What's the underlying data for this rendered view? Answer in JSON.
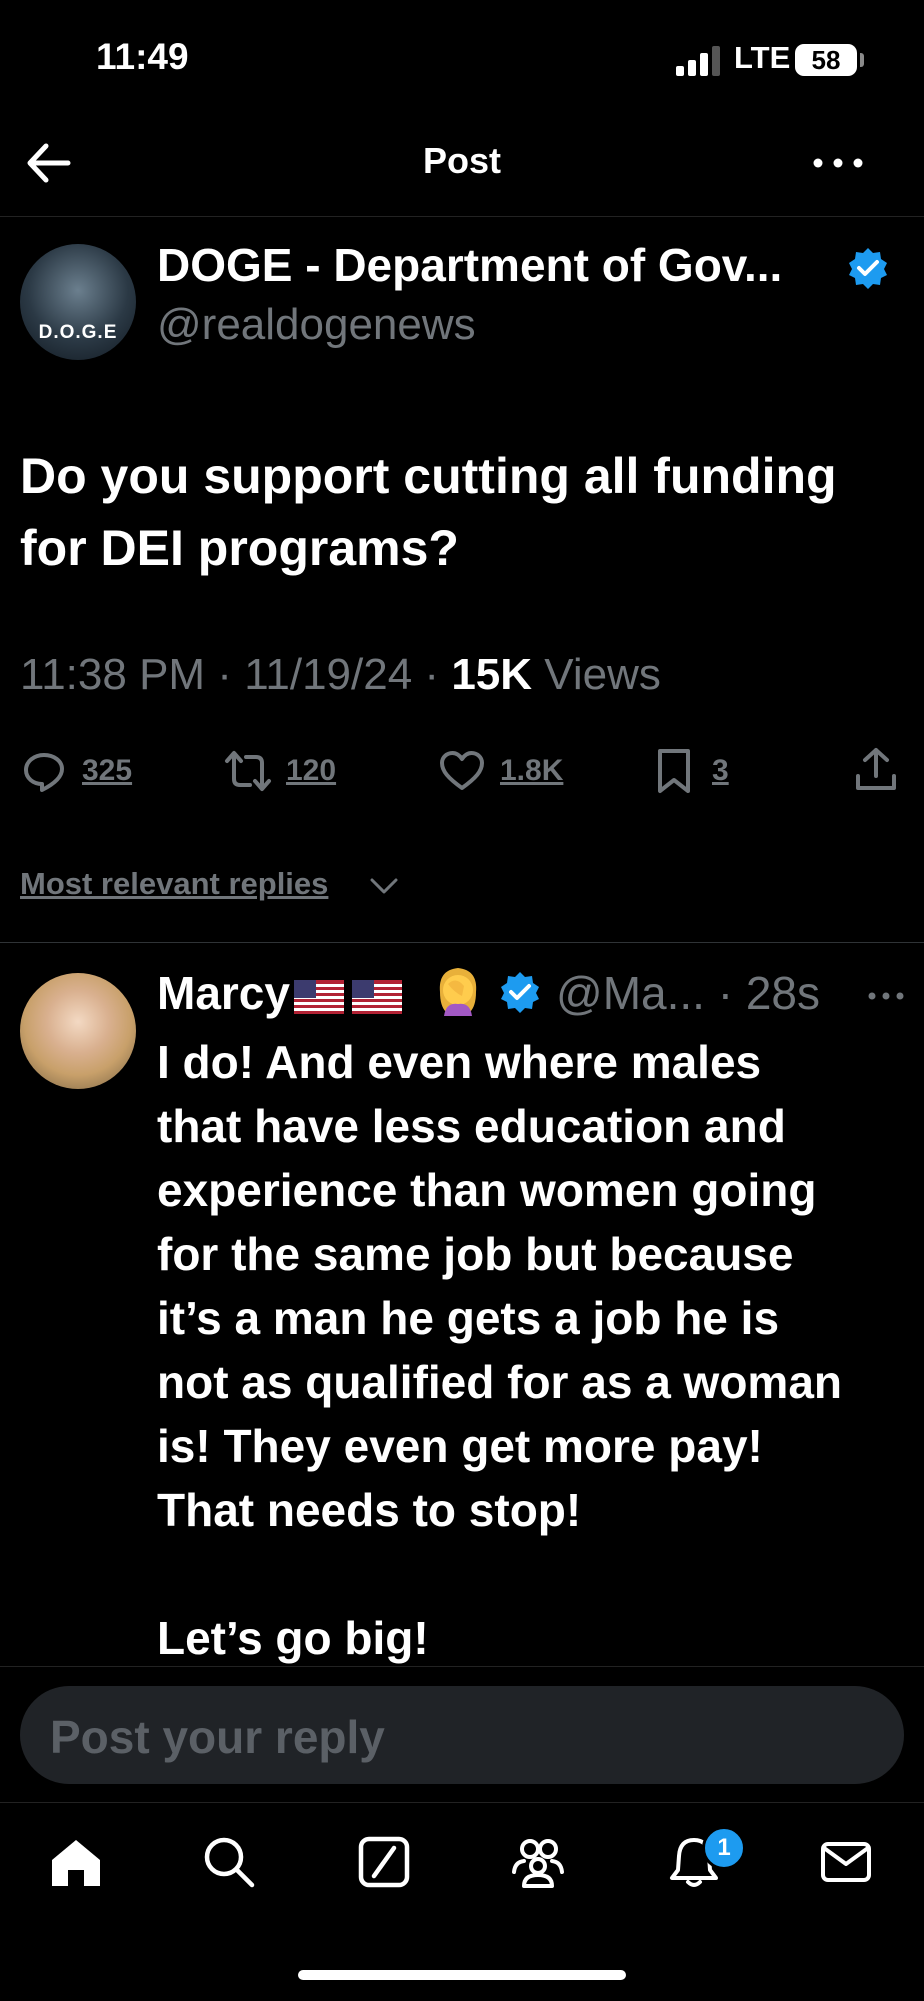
{
  "status_bar": {
    "time": "11:49",
    "network": "LTE",
    "battery": "58"
  },
  "header": {
    "title": "Post",
    "back_icon": "arrow-left-icon",
    "more_icon": "more-horizontal-icon"
  },
  "post": {
    "author_name": "DOGE - Department of Gov...",
    "author_handle": "@realdogenews",
    "avatar_text": "D.O.G.E",
    "text": "Do you support cutting all funding for DEI programs?",
    "time": "11:38 PM",
    "date": "11/19/24",
    "views_count": "15K",
    "views_label": "Views",
    "actions": {
      "replies": "325",
      "reposts": "120",
      "likes": "1.8K",
      "bookmarks": "3"
    }
  },
  "replies_sort": {
    "label": "Most relevant replies"
  },
  "reply": {
    "name": "Marcy",
    "handle": "@Ma...",
    "age": "28s",
    "text_lines": [
      "I do! And even where males",
      "that have less education and",
      "experience than women going",
      "for the same job but because",
      "it’s a man he gets a job he is",
      "not as qualified for as a woman",
      "is! They even get more pay!",
      "That needs to stop!",
      "",
      "Let’s go big!"
    ]
  },
  "composer": {
    "placeholder": "Post your reply"
  },
  "tabbar": {
    "notification_badge": "1"
  },
  "colors": {
    "background": "#000000",
    "text": "#e7e9ea",
    "muted": "#71767b",
    "accent": "#1d9bf0"
  }
}
